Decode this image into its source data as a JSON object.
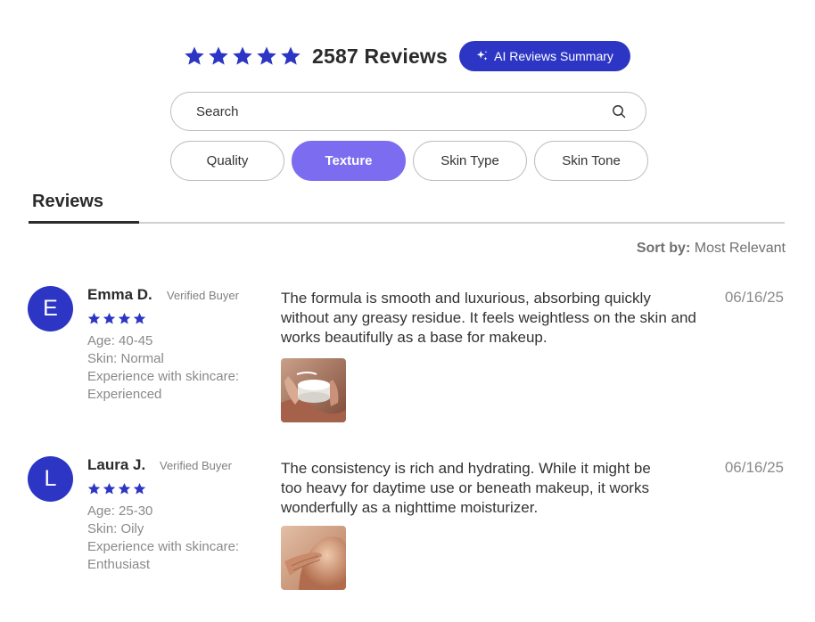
{
  "summary": {
    "rating_stars": 5,
    "review_count": "2587 Reviews",
    "ai_button_label": "AI Reviews Summary",
    "star_color": "#2d36c4"
  },
  "search": {
    "placeholder": "Search"
  },
  "filters": [
    {
      "label": "Quality",
      "active": false
    },
    {
      "label": "Texture",
      "active": true
    },
    {
      "label": "Skin Type",
      "active": false
    },
    {
      "label": "Skin Tone",
      "active": false
    }
  ],
  "tabs": {
    "reviews_label": "Reviews"
  },
  "sort": {
    "label": "Sort by:",
    "value": "Most Relevant"
  },
  "reviews": [
    {
      "initial": "E",
      "name": "Emma D.",
      "verified": "Verified Buyer",
      "stars": 4,
      "age": "Age: 40-45",
      "skin": "Skin: Normal",
      "experience": "Experience with skincare: Experienced",
      "text": "The formula is smooth and luxurious, absorbing quickly without any greasy residue. It feels weightless on the skin and works beautifully as a base for makeup.",
      "date": "06/16/25",
      "photo_icon": "cream-jar-photo"
    },
    {
      "initial": "L",
      "name": "Laura J.",
      "verified": "Verified Buyer",
      "stars": 4,
      "age": "Age: 25-30",
      "skin": "Skin: Oily",
      "experience": "Experience with skincare: Enthusiast",
      "text": "The consistency is rich and hydrating. While it might be too heavy for daytime use or beneath makeup, it works wonderfully as a nighttime moisturizer.",
      "date": "06/16/25",
      "photo_icon": "shoulder-photo"
    }
  ],
  "colors": {
    "accent": "#2d36c4",
    "chip_active": "#7b6cf0"
  }
}
